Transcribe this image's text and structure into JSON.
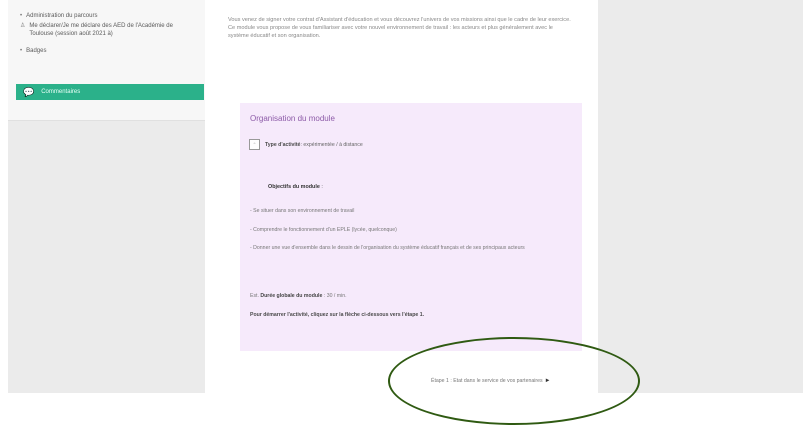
{
  "sidebar": {
    "items": [
      {
        "glyph": "•",
        "label": "Administration du parcours"
      },
      {
        "glyph": "♙",
        "label": "Me déclarer/Je me déclare des AED de l'Académie de Toulouse (session août 2021 à)"
      },
      {
        "glyph": "•",
        "label": "Badges"
      }
    ],
    "comments_label": "Commentaires"
  },
  "intro": {
    "text": "Vous venez de signer votre contrat d'Assistant d'éducation et vous découvrez l'univers de vos missions ainsi que le cadre de leur exercice. Ce module vous propose de vous familiariser avec votre nouvel environnement de travail : les acteurs et plus généralement avec le système éducatif et son organisation."
  },
  "module": {
    "title": "Organisation du module",
    "type_label": "Type d'activité",
    "type_value": ": expérimentée / à distance",
    "objectives_title": "Objectifs du module",
    "objectives_suffix": " :",
    "objectives": [
      "- Se situer dans son environnement de travail",
      "- Comprendre le fonctionnement d'un EPLE (lycée, quelconque)",
      "- Donner une vue d'ensemble dans le dessin de l'organisation du système éducatif français et de ses principaux acteurs"
    ],
    "duration_prefix": "Est. ",
    "duration_label": "Durée globale du module",
    "duration_value": " : 30 / min.",
    "start_text": "Pour démarrer l'activité, cliquez sur la flèche ci-dessous vers l'étape 1."
  },
  "navigation": {
    "next_label": "Étape 1 : Etat dans le service de vos partenaires",
    "next_arrow": "►"
  },
  "colors": {
    "accent": "#2bb18a",
    "module_bg": "#f6eafb",
    "module_title": "#8d5ba8",
    "annotation": "#2f5a12"
  }
}
